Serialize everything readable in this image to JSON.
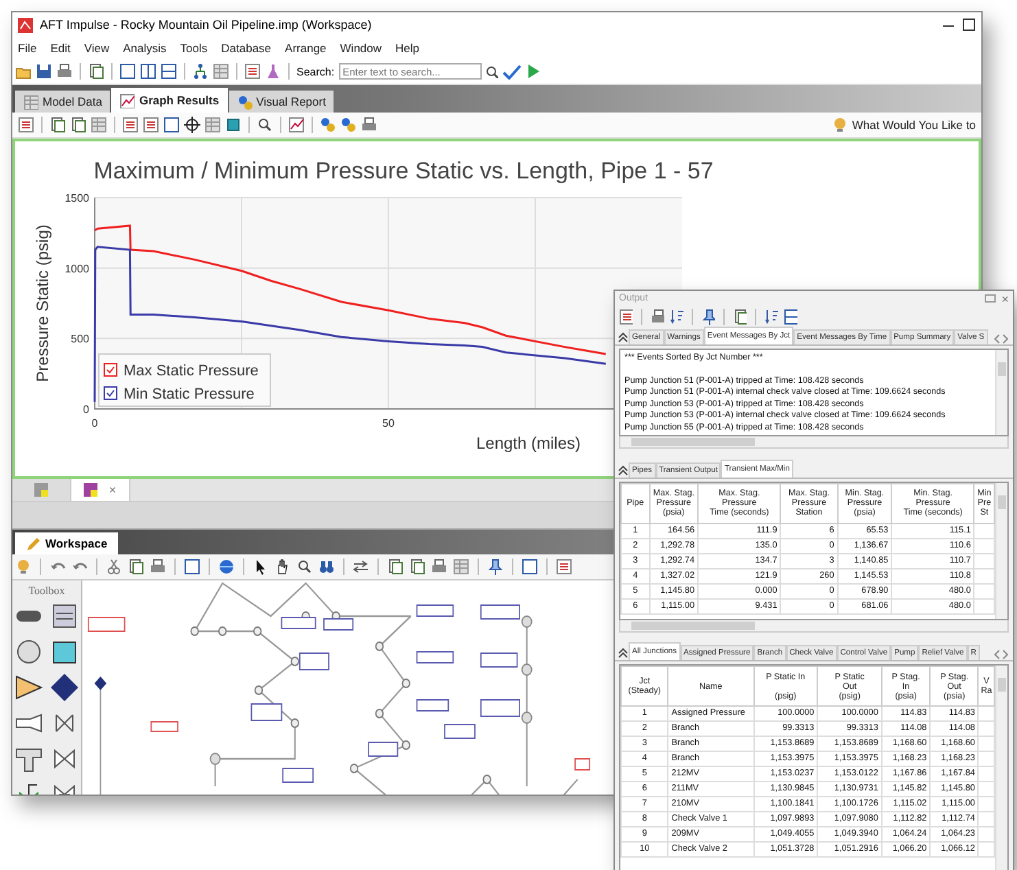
{
  "window": {
    "title": "AFT Impulse - Rocky Mountain Oil Pipeline.imp (Workspace)"
  },
  "menu": [
    "File",
    "Edit",
    "View",
    "Analysis",
    "Tools",
    "Database",
    "Arrange",
    "Window",
    "Help"
  ],
  "toolbar": {
    "search_label": "Search:",
    "search": {
      "placeholder": "Enter text to search..."
    }
  },
  "tabs": [
    {
      "label": "Model Data",
      "selected": false
    },
    {
      "label": "Graph Results",
      "selected": true
    },
    {
      "label": "Visual Report",
      "selected": false
    }
  ],
  "graph_toolbar": {
    "help_prompt": "What Would You Like to"
  },
  "graph": {
    "chart_data": {
      "type": "line",
      "title": "Maximum / Minimum Pressure Static vs. Length, Pipe 1 - 57",
      "xlabel": "Length (miles)",
      "ylabel": "Pressure Static (psig)",
      "xlim": [
        0,
        100
      ],
      "ylim": [
        0,
        1500
      ],
      "xticks": [
        0,
        50
      ],
      "yticks": [
        0,
        500,
        1000,
        1500
      ],
      "grid": true,
      "x": [
        0,
        0.1,
        0.5,
        6,
        6.1,
        10,
        17,
        25,
        30,
        35,
        42,
        50,
        57,
        63,
        66,
        70,
        80,
        87
      ],
      "series": [
        {
          "name": "Max Static Pressure",
          "color": "#f02020",
          "values": [
            1270,
            1270,
            1280,
            1300,
            1130,
            1120,
            1060,
            980,
            910,
            850,
            760,
            700,
            640,
            610,
            580,
            520,
            440,
            390
          ]
        },
        {
          "name": "Min Static Pressure",
          "color": "#3a3aa8",
          "values": [
            50,
            1130,
            1150,
            1130,
            670,
            670,
            650,
            620,
            590,
            560,
            510,
            480,
            460,
            450,
            440,
            400,
            360,
            320
          ]
        }
      ],
      "legend": {
        "items": [
          {
            "checked": true
          },
          {
            "checked": true
          }
        ]
      }
    }
  },
  "document_tabs": [
    {
      "selected": false
    },
    {
      "selected": true,
      "close": "×"
    }
  ],
  "workspace": {
    "tab": "Workspace",
    "toolbox_title": "Toolbox"
  },
  "output": {
    "title": "Output",
    "close": "×",
    "message_tabs": [
      {
        "label": "General",
        "selected": false
      },
      {
        "label": "Warnings",
        "selected": false
      },
      {
        "label": "Event Messages By Jct",
        "selected": true
      },
      {
        "label": "Event Messages By Time",
        "selected": false
      },
      {
        "label": "Pump Summary",
        "selected": false
      },
      {
        "label": "Valve S",
        "selected": false
      }
    ],
    "messages": {
      "heading": "*** Events Sorted By Jct Number ***",
      "lines": [
        "Pump Junction 51 (P-001-A) tripped at Time: 108.428 seconds",
        "Pump Junction 51 (P-001-A) internal check valve closed at Time: 109.6624 seconds",
        "Pump Junction 53 (P-001-A) tripped at Time: 108.428 seconds",
        "Pump Junction 53 (P-001-A) internal check valve closed at Time: 109.6624 seconds",
        "Pump Junction 55 (P-001-A) tripped at Time: 108.428 seconds"
      ]
    },
    "pipe_tabs": [
      {
        "label": "Pipes",
        "selected": false
      },
      {
        "label": "Transient Output",
        "selected": false
      },
      {
        "label": "Transient Max/Min",
        "selected": true
      }
    ],
    "pipe_table": {
      "columns": [
        "Pipe",
        "Max. Stag.\nPressure\n(psia)",
        "Max. Stag.\nPressure\nTime (seconds)",
        "Max. Stag.\nPressure\nStation",
        "Min. Stag.\nPressure\n(psia)",
        "Min. Stag.\nPressure\nTime (seconds)",
        "Min\nPre\nSt"
      ],
      "rows": [
        [
          "1",
          "164.56",
          "111.9",
          "6",
          "65.53",
          "115.1"
        ],
        [
          "2",
          "1,292.78",
          "135.0",
          "0",
          "1,136.67",
          "110.6"
        ],
        [
          "3",
          "1,292.74",
          "134.7",
          "3",
          "1,140.85",
          "110.7"
        ],
        [
          "4",
          "1,327.02",
          "121.9",
          "260",
          "1,145.53",
          "110.8"
        ],
        [
          "5",
          "1,145.80",
          "0.000",
          "0",
          "678.90",
          "480.0"
        ],
        [
          "6",
          "1,115.00",
          "9.431",
          "0",
          "681.06",
          "480.0"
        ]
      ]
    },
    "junction_tabs": [
      {
        "label": "All Junctions",
        "selected": true
      },
      {
        "label": "Assigned Pressure",
        "selected": false
      },
      {
        "label": "Branch",
        "selected": false
      },
      {
        "label": "Check Valve",
        "selected": false
      },
      {
        "label": "Control Valve",
        "selected": false
      },
      {
        "label": "Pump",
        "selected": false
      },
      {
        "label": "Relief Valve",
        "selected": false
      },
      {
        "label": "R",
        "selected": false
      }
    ],
    "junction_table": {
      "columns": [
        "Jct\n(Steady)",
        "Name",
        "P Static In\n\n(psig)",
        "P Static\nOut\n(psig)",
        "P Stag.\nIn\n(psia)",
        "P Stag.\nOut\n(psia)",
        "V\nRa"
      ],
      "rows": [
        [
          "1",
          "Assigned Pressure",
          "100.0000",
          "100.0000",
          "114.83",
          "114.83"
        ],
        [
          "2",
          "Branch",
          "99.3313",
          "99.3313",
          "114.08",
          "114.08"
        ],
        [
          "3",
          "Branch",
          "1,153.8689",
          "1,153.8689",
          "1,168.60",
          "1,168.60"
        ],
        [
          "4",
          "Branch",
          "1,153.3975",
          "1,153.3975",
          "1,168.23",
          "1,168.23"
        ],
        [
          "5",
          "212MV",
          "1,153.0237",
          "1,153.0122",
          "1,167.86",
          "1,167.84"
        ],
        [
          "6",
          "211MV",
          "1,130.9845",
          "1,130.9731",
          "1,145.82",
          "1,145.80"
        ],
        [
          "7",
          "210MV",
          "1,100.1841",
          "1,100.1726",
          "1,115.02",
          "1,115.00"
        ],
        [
          "8",
          "Check Valve 1",
          "1,097.9893",
          "1,097.9080",
          "1,112.82",
          "1,112.74"
        ],
        [
          "9",
          "209MV",
          "1,049.4055",
          "1,049.3940",
          "1,064.24",
          "1,064.23"
        ],
        [
          "10",
          "Check Valve 2",
          "1,051.3728",
          "1,051.2916",
          "1,066.20",
          "1,066.12"
        ]
      ]
    }
  }
}
